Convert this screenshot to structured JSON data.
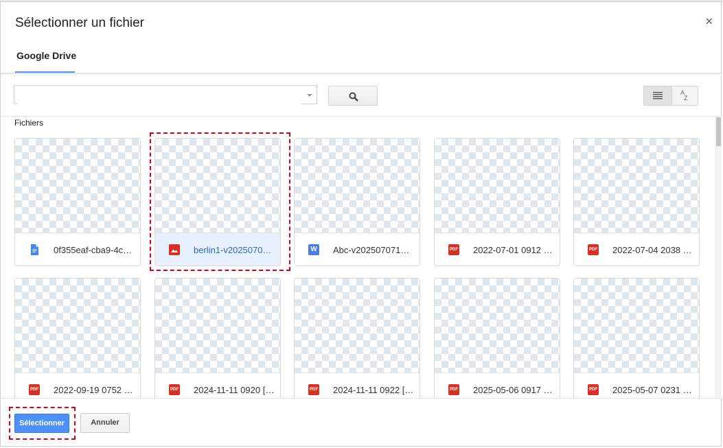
{
  "dialog": {
    "title": "Sélectionner un fichier",
    "close_label": "×"
  },
  "tabs": [
    {
      "label": "Google Drive",
      "active": true
    }
  ],
  "toolbar": {
    "search_value": "",
    "search_icon": "search-icon",
    "list_view_icon": "list-view-icon",
    "sort_icon": "sort-az-icon",
    "sort_label_top": "A",
    "sort_label_bottom": "Z"
  },
  "content": {
    "section_label": "Fichiers",
    "files": [
      {
        "name": "0f355eaf-cba9-4c…",
        "icon": "google-docs-icon",
        "selected": false
      },
      {
        "name": "berlin1-v2025070…",
        "icon": "image-icon",
        "selected": true
      },
      {
        "name": "Abc-v2025070710…",
        "icon": "word-icon",
        "selected": false
      },
      {
        "name": "2022-07-01 0912 […",
        "icon": "pdf-icon",
        "selected": false
      },
      {
        "name": "2022-07-04 2038 […",
        "icon": "pdf-icon",
        "selected": false
      },
      {
        "name": "2022-09-19 0752 […",
        "icon": "pdf-icon",
        "selected": false
      },
      {
        "name": "2024-11-11 0920 […",
        "icon": "pdf-icon",
        "selected": false
      },
      {
        "name": "2024-11-11 0922 […",
        "icon": "pdf-icon",
        "selected": false
      },
      {
        "name": "2025-05-06 0917 […",
        "icon": "pdf-icon",
        "selected": false
      },
      {
        "name": "2025-05-07 0231 […",
        "icon": "pdf-icon",
        "selected": false
      }
    ]
  },
  "footer": {
    "select_label": "Sélectionner",
    "cancel_label": "Annuler"
  },
  "colors": {
    "accent": "#4d90fe",
    "highlight": "#d6001c",
    "pdf": "#d93025",
    "word": "#4a7de2",
    "docs": "#4285f4"
  },
  "icon_text": {
    "pdf": "PDF",
    "word": "W"
  }
}
